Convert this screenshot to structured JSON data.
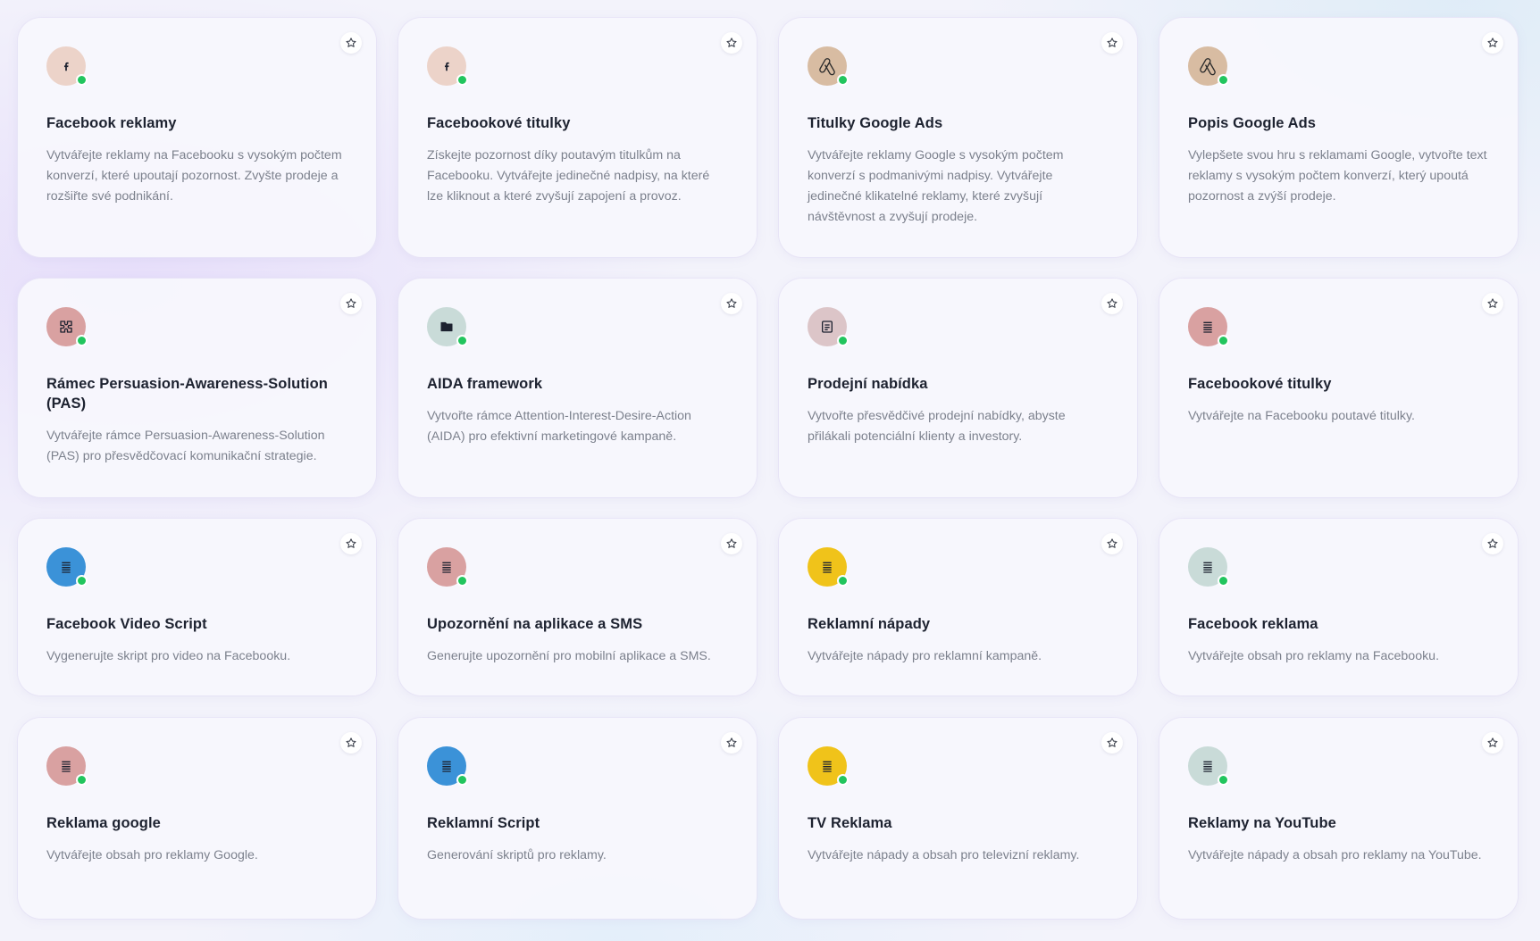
{
  "colors": {
    "online": "#22c55e",
    "title": "#1d2230",
    "description": "#7c818d"
  },
  "cards": [
    {
      "title": "Facebook reklamy",
      "description": "Vytvářejte reklamy na Facebooku s vysokým počtem konverzí, které upoutají pozornost. Zvyšte prodeje a rozšiřte své podnikání.",
      "icon": "facebook-icon",
      "icon_bg": "#ecd3c9"
    },
    {
      "title": "Facebookové titulky",
      "description": "Získejte pozornost díky poutavým titulkům na Facebooku. Vytvářejte jedinečné nadpisy, na které lze kliknout a které zvyšují zapojení a provoz.",
      "icon": "facebook-icon",
      "icon_bg": "#ecd3c9"
    },
    {
      "title": "Titulky Google Ads",
      "description": "Vytvářejte reklamy Google s vysokým počtem konverzí s podmanivými nadpisy. Vytvářejte jedinečné klikatelné reklamy, které zvyšují návštěvnost a zvyšují prodeje.",
      "icon": "google-ads-icon",
      "icon_bg": "#d8bca2"
    },
    {
      "title": "Popis Google Ads",
      "description": "Vylepšete svou hru s reklamami Google, vytvořte text reklamy s vysokým počtem konverzí, který upoutá pozornost a zvýší prodeje.",
      "icon": "google-ads-icon",
      "icon_bg": "#d8bca2"
    },
    {
      "title": "Rámec Persuasion-Awareness-Solution (PAS)",
      "description": "Vytvářejte rámce Persuasion-Awareness-Solution (PAS) pro přesvědčovací komunikační strategie.",
      "icon": "puzzle-icon",
      "icon_bg": "#d9a1a1"
    },
    {
      "title": "AIDA framework",
      "description": "Vytvořte rámce Attention-Interest-Desire-Action (AIDA) pro efektivní marketingové kampaně.",
      "icon": "folder-icon",
      "icon_bg": "#c9dbd8"
    },
    {
      "title": "Prodejní nabídka",
      "description": "Vytvořte přesvědčivé prodejní nabídky, abyste přilákali potenciální klienty a investory.",
      "icon": "document-icon",
      "icon_bg": "#dcc5c8"
    },
    {
      "title": "Facebookové titulky",
      "description": "Vytvářejte na Facebooku poutavé titulky.",
      "icon": "text-lines-icon",
      "icon_bg": "#d9a1a1"
    },
    {
      "title": "Facebook Video Script",
      "description": "Vygenerujte skript pro video na Facebooku.",
      "icon": "text-lines-icon",
      "icon_bg": "#3b92d8"
    },
    {
      "title": "Upozornění na aplikace a SMS",
      "description": "Generujte upozornění pro mobilní aplikace a SMS.",
      "icon": "text-lines-icon",
      "icon_bg": "#d9a1a1"
    },
    {
      "title": "Reklamní nápady",
      "description": "Vytvářejte nápady pro reklamní kampaně.",
      "icon": "text-lines-icon",
      "icon_bg": "#f0c31a"
    },
    {
      "title": "Facebook reklama",
      "description": "Vytvářejte obsah pro reklamy na Facebooku.",
      "icon": "text-lines-icon",
      "icon_bg": "#c9dbd8"
    },
    {
      "title": "Reklama google",
      "description": "Vytvářejte obsah pro reklamy Google.",
      "icon": "text-lines-icon",
      "icon_bg": "#d9a1a1"
    },
    {
      "title": "Reklamní Script",
      "description": "Generování skriptů pro reklamy.",
      "icon": "text-lines-icon",
      "icon_bg": "#3b92d8"
    },
    {
      "title": "TV Reklama",
      "description": "Vytvářejte nápady a obsah pro televizní reklamy.",
      "icon": "text-lines-icon",
      "icon_bg": "#f0c31a"
    },
    {
      "title": "Reklamy na YouTube",
      "description": "Vytvářejte nápady a obsah pro reklamy na YouTube.",
      "icon": "text-lines-icon",
      "icon_bg": "#c9dbd8"
    }
  ]
}
